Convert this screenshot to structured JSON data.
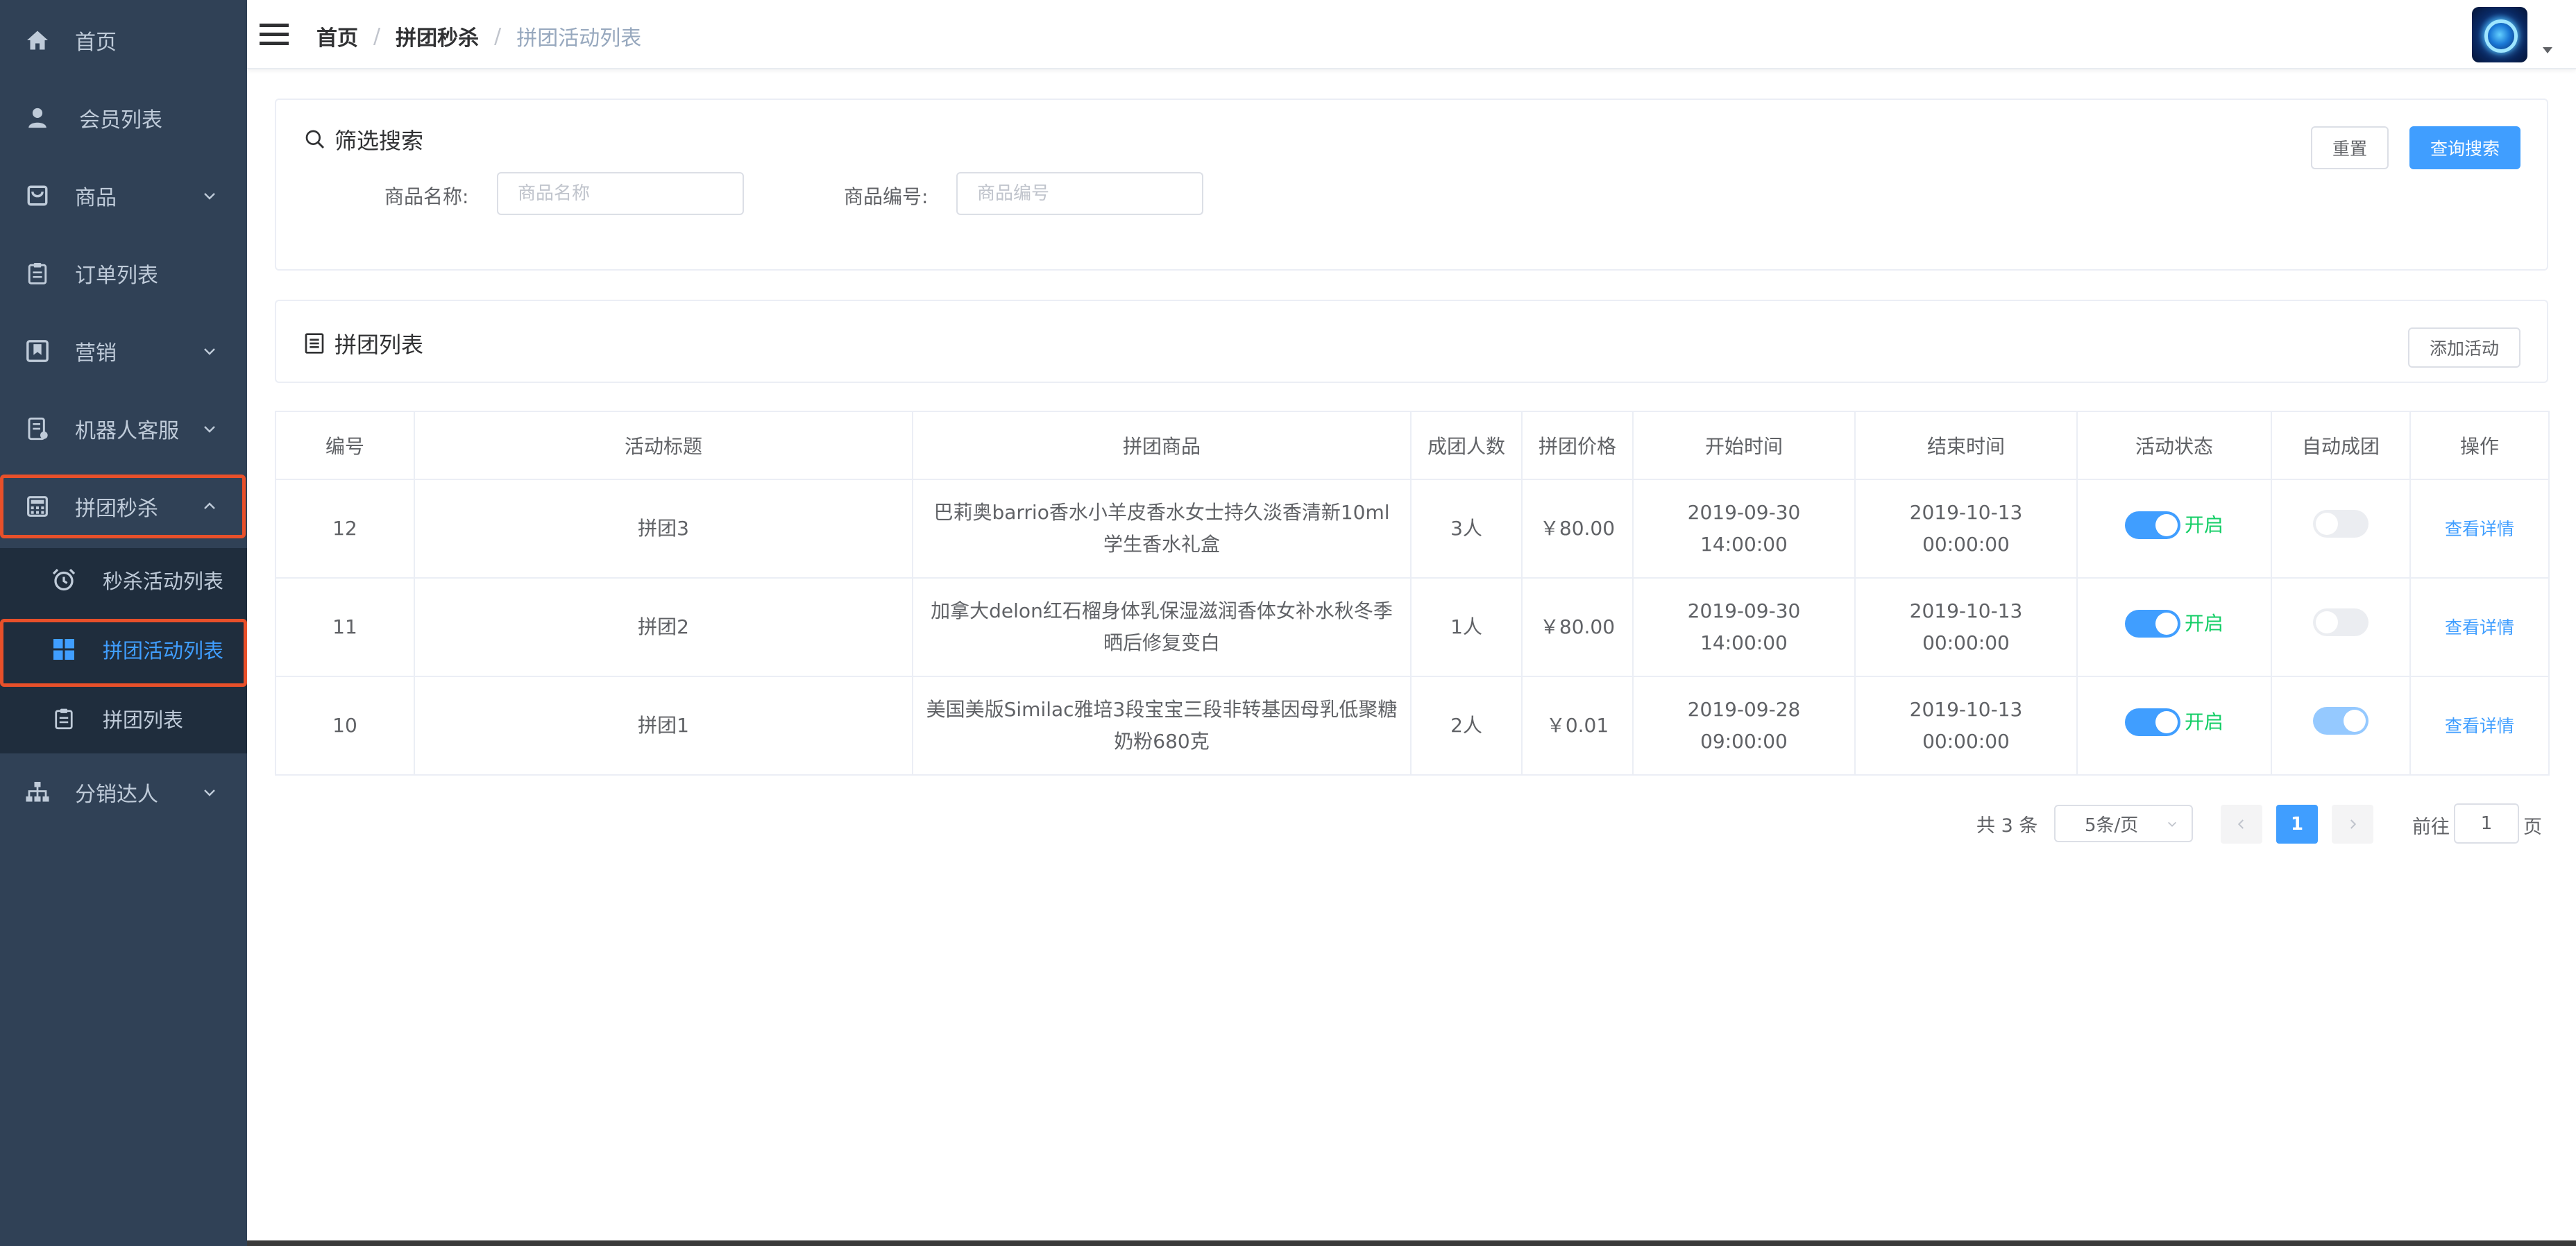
{
  "sidebar": {
    "items": [
      {
        "label": "首页",
        "icon": "home-icon",
        "has_arrow": false
      },
      {
        "label": "会员列表",
        "icon": "user-icon",
        "has_arrow": false
      },
      {
        "label": "商品",
        "icon": "shopping-bag-icon",
        "has_arrow": true
      },
      {
        "label": "订单列表",
        "icon": "clipboard-icon",
        "has_arrow": false
      },
      {
        "label": "营销",
        "icon": "bookmark-icon",
        "has_arrow": true
      },
      {
        "label": "机器人客服",
        "icon": "robot-doc-icon",
        "has_arrow": true
      },
      {
        "label": "拼团秒杀",
        "icon": "calculator-icon",
        "has_arrow": true,
        "expanded": true
      },
      {
        "label": "分销达人",
        "icon": "org-tree-icon",
        "has_arrow": true
      }
    ],
    "submenu": [
      {
        "label": "秒杀活动列表",
        "icon": "alarm-clock-icon"
      },
      {
        "label": "拼团活动列表",
        "icon": "grid-icon",
        "active": true
      },
      {
        "label": "拼团列表",
        "icon": "clipboard-icon"
      }
    ]
  },
  "navbar": {
    "breadcrumb": [
      "首页",
      "拼团秒杀",
      "拼团活动列表"
    ],
    "separator": "/"
  },
  "filter": {
    "title": "筛选搜索",
    "reset_label": "重置",
    "search_label": "查询搜索",
    "name_label": "商品名称:",
    "name_placeholder": "商品名称",
    "code_label": "商品编号:",
    "code_placeholder": "商品编号"
  },
  "list_card": {
    "title": "拼团列表",
    "add_label": "添加活动"
  },
  "table": {
    "columns": [
      "编号",
      "活动标题",
      "拼团商品",
      "成团人数",
      "拼团价格",
      "开始时间",
      "结束时间",
      "活动状态",
      "自动成团",
      "操作"
    ],
    "rows": [
      {
        "id": "12",
        "title": "拼团3",
        "goods": "巴莉奥barrio香水小羊皮香水女士持久淡香清新10ml学生香水礼盒",
        "people": "3人",
        "price": "￥80.00",
        "start": "2019-09-30 14:00:00",
        "end": "2019-10-13 00:00:00",
        "status_on": true,
        "status_text": "开启",
        "auto_on": false,
        "action": "查看详情"
      },
      {
        "id": "11",
        "title": "拼团2",
        "goods": "加拿大delon红石榴身体乳保湿滋润香体女补水秋冬季晒后修复变白",
        "people": "1人",
        "price": "￥80.00",
        "start": "2019-09-30 14:00:00",
        "end": "2019-10-13 00:00:00",
        "status_on": true,
        "status_text": "开启",
        "auto_on": false,
        "action": "查看详情"
      },
      {
        "id": "10",
        "title": "拼团1",
        "goods": "美国美版Similac雅培3段宝宝三段非转基因母乳低聚糖奶粉680克",
        "people": "2人",
        "price": "￥0.01",
        "start": "2019-09-28 09:00:00",
        "end": "2019-10-13 00:00:00",
        "status_on": true,
        "status_text": "开启",
        "auto_on": true,
        "action": "查看详情"
      }
    ]
  },
  "pagination": {
    "total": "共 3 条",
    "page_size": "5条/页",
    "current_page": "1",
    "goto_label": "前往",
    "goto_value": "1",
    "page_suffix": "页"
  },
  "colors": {
    "sidebar_bg": "#304156",
    "submenu_bg": "#1f2d3d",
    "accent": "#409eff",
    "status_green": "#13ce66",
    "highlight_box": "#e8502a"
  }
}
